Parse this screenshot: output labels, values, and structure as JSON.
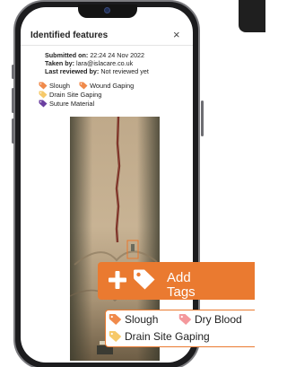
{
  "panel": {
    "title": "Identified features",
    "close_symbol": "×"
  },
  "meta": {
    "submitted_label": "Submitted on:",
    "submitted_value": "22:24 24 Nov 2022",
    "taken_label": "Taken by:",
    "taken_value": "lara@islacare.co.uk",
    "reviewed_label": "Last reviewed by:",
    "reviewed_value": "Not reviewed yet"
  },
  "feature_tags": [
    {
      "label": "Slough",
      "color": "#f08a4b",
      "icon": "tag-icon"
    },
    {
      "label": "Wound Gaping",
      "color": "#f08a4b",
      "icon": "tag-icon"
    },
    {
      "label": "Drain Site Gaping",
      "color": "#f6c96a",
      "icon": "tag-icon"
    },
    {
      "label": "Suture Material",
      "color": "#6b3fa0",
      "icon": "tag-icon"
    }
  ],
  "add_tags": {
    "label": "Add Tags",
    "background": "#ea7a30",
    "icons": [
      "plus-icon",
      "tag-icon"
    ]
  },
  "tag_legend": [
    {
      "label": "Slough",
      "color": "#f08a4b",
      "icon": "tag-icon"
    },
    {
      "label": "Dry Blood",
      "color": "#f4989c",
      "icon": "tag-icon"
    },
    {
      "label": "Drain Site Gaping",
      "color": "#f6c96a",
      "icon": "tag-icon"
    }
  ]
}
